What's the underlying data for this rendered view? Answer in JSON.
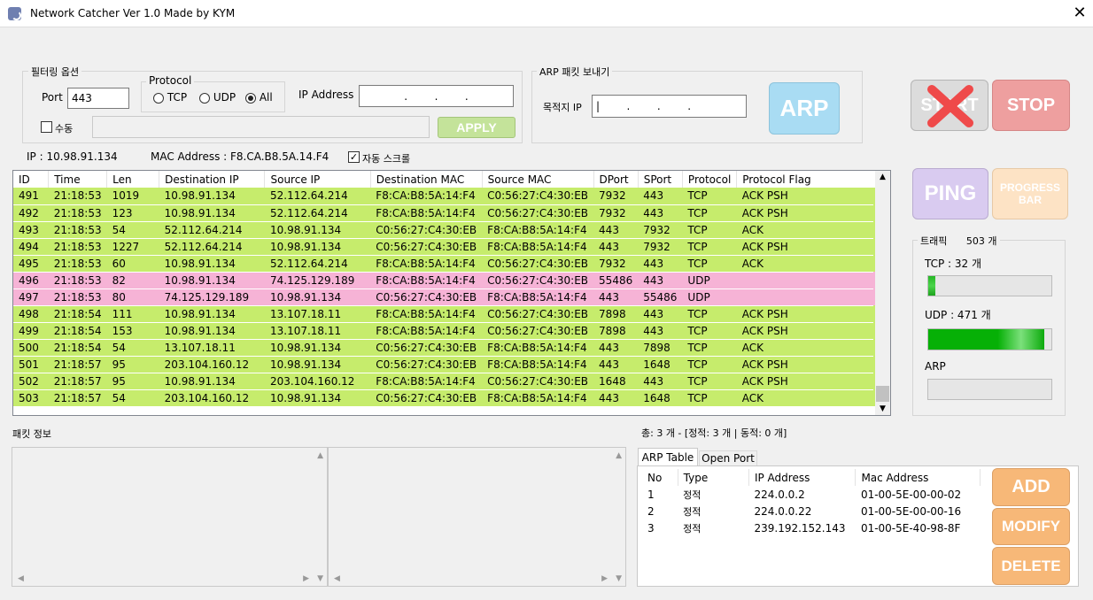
{
  "window": {
    "title": "Network Catcher Ver 1.0 Made by KYM",
    "close": "✕"
  },
  "filter": {
    "group_label": "필터링 옵션",
    "port_label": "Port",
    "port_value": "443",
    "protocol_label": "Protocol",
    "protocols": [
      "TCP",
      "UDP",
      "All"
    ],
    "selected_protocol": "All",
    "ip_label": "IP Address",
    "ip_value": ".        .        .",
    "manual_label": "수동",
    "apply_label": "APPLY"
  },
  "arp_send": {
    "group_label": "ARP 패킷 보내기",
    "dest_ip_label": "목적지 IP",
    "dest_ip_value": "|        .        .        .",
    "button": "ARP"
  },
  "controls": {
    "start": "START",
    "stop": "STOP",
    "ping": "PING",
    "progress": "PROGRESS BAR"
  },
  "status": {
    "ip": "IP : 10.98.91.134",
    "mac": "MAC Address : F8.CA.B8.5A.14.F4",
    "autoscroll_label": "자동 스크롤",
    "autoscroll_checked": true
  },
  "packets": {
    "columns": [
      "ID",
      "Time",
      "Len",
      "Destination IP",
      "Source IP",
      "Destination MAC",
      "Source MAC",
      "DPort",
      "SPort",
      "Protocol",
      "Protocol Flag"
    ],
    "rows": [
      [
        "491",
        "21:18:53",
        "1019",
        "10.98.91.134",
        "52.112.64.214",
        "F8:CA:B8:5A:14:F4",
        "C0:56:27:C4:30:EB",
        "7932",
        "443",
        "TCP",
        "ACK PSH"
      ],
      [
        "492",
        "21:18:53",
        "123",
        "10.98.91.134",
        "52.112.64.214",
        "F8:CA:B8:5A:14:F4",
        "C0:56:27:C4:30:EB",
        "7932",
        "443",
        "TCP",
        "ACK PSH"
      ],
      [
        "493",
        "21:18:53",
        "54",
        "52.112.64.214",
        "10.98.91.134",
        "C0:56:27:C4:30:EB",
        "F8:CA:B8:5A:14:F4",
        "443",
        "7932",
        "TCP",
        "ACK"
      ],
      [
        "494",
        "21:18:53",
        "1227",
        "52.112.64.214",
        "10.98.91.134",
        "C0:56:27:C4:30:EB",
        "F8:CA:B8:5A:14:F4",
        "443",
        "7932",
        "TCP",
        "ACK PSH"
      ],
      [
        "495",
        "21:18:53",
        "60",
        "10.98.91.134",
        "52.112.64.214",
        "F8:CA:B8:5A:14:F4",
        "C0:56:27:C4:30:EB",
        "7932",
        "443",
        "TCP",
        "ACK"
      ],
      [
        "496",
        "21:18:53",
        "82",
        "10.98.91.134",
        "74.125.129.189",
        "F8:CA:B8:5A:14:F4",
        "C0:56:27:C4:30:EB",
        "55486",
        "443",
        "UDP",
        ""
      ],
      [
        "497",
        "21:18:53",
        "80",
        "74.125.129.189",
        "10.98.91.134",
        "C0:56:27:C4:30:EB",
        "F8:CA:B8:5A:14:F4",
        "443",
        "55486",
        "UDP",
        ""
      ],
      [
        "498",
        "21:18:54",
        "111",
        "10.98.91.134",
        "13.107.18.11",
        "F8:CA:B8:5A:14:F4",
        "C0:56:27:C4:30:EB",
        "7898",
        "443",
        "TCP",
        "ACK PSH"
      ],
      [
        "499",
        "21:18:54",
        "153",
        "10.98.91.134",
        "13.107.18.11",
        "F8:CA:B8:5A:14:F4",
        "C0:56:27:C4:30:EB",
        "7898",
        "443",
        "TCP",
        "ACK PSH"
      ],
      [
        "500",
        "21:18:54",
        "54",
        "13.107.18.11",
        "10.98.91.134",
        "C0:56:27:C4:30:EB",
        "F8:CA:B8:5A:14:F4",
        "443",
        "7898",
        "TCP",
        "ACK"
      ],
      [
        "501",
        "21:18:57",
        "95",
        "203.104.160.12",
        "10.98.91.134",
        "C0:56:27:C4:30:EB",
        "F8:CA:B8:5A:14:F4",
        "443",
        "1648",
        "TCP",
        "ACK PSH"
      ],
      [
        "502",
        "21:18:57",
        "95",
        "10.98.91.134",
        "203.104.160.12",
        "F8:CA:B8:5A:14:F4",
        "C0:56:27:C4:30:EB",
        "1648",
        "443",
        "TCP",
        "ACK PSH"
      ],
      [
        "503",
        "21:18:57",
        "54",
        "203.104.160.12",
        "10.98.91.134",
        "C0:56:27:C4:30:EB",
        "F8:CA:B8:5A:14:F4",
        "443",
        "1648",
        "TCP",
        "ACK"
      ]
    ]
  },
  "traffic": {
    "label": "트래픽",
    "total": "503 개",
    "tcp_label": "TCP : 32 개",
    "tcp_fraction": 0.06,
    "udp_label": "UDP : 471 개",
    "udp_fraction": 0.94,
    "arp_label": "ARP",
    "arp_fraction": 0
  },
  "packet_info": {
    "label": "패킷 정보"
  },
  "arp_table": {
    "summary": "총: 3 개 - [정적: 3 개 | 동적: 0 개]",
    "tabs": [
      "ARP Table",
      "Open Port"
    ],
    "columns": [
      "No",
      "Type",
      "IP Address",
      "Mac Address"
    ],
    "rows": [
      [
        "1",
        "정적",
        "224.0.0.2",
        "01-00-5E-00-00-02"
      ],
      [
        "2",
        "정적",
        "224.0.0.22",
        "01-00-5E-00-00-16"
      ],
      [
        "3",
        "정적",
        "239.192.152.143",
        "01-00-5E-40-98-8F"
      ]
    ],
    "buttons": {
      "add": "ADD",
      "modify": "MODIFY",
      "delete": "DELETE"
    }
  },
  "colors": {
    "tcp_row": "#c6ec6c",
    "udp_row": "#f6b3d6",
    "accent_orange": "#f7b878",
    "arp_blue": "#a9dcf3"
  }
}
